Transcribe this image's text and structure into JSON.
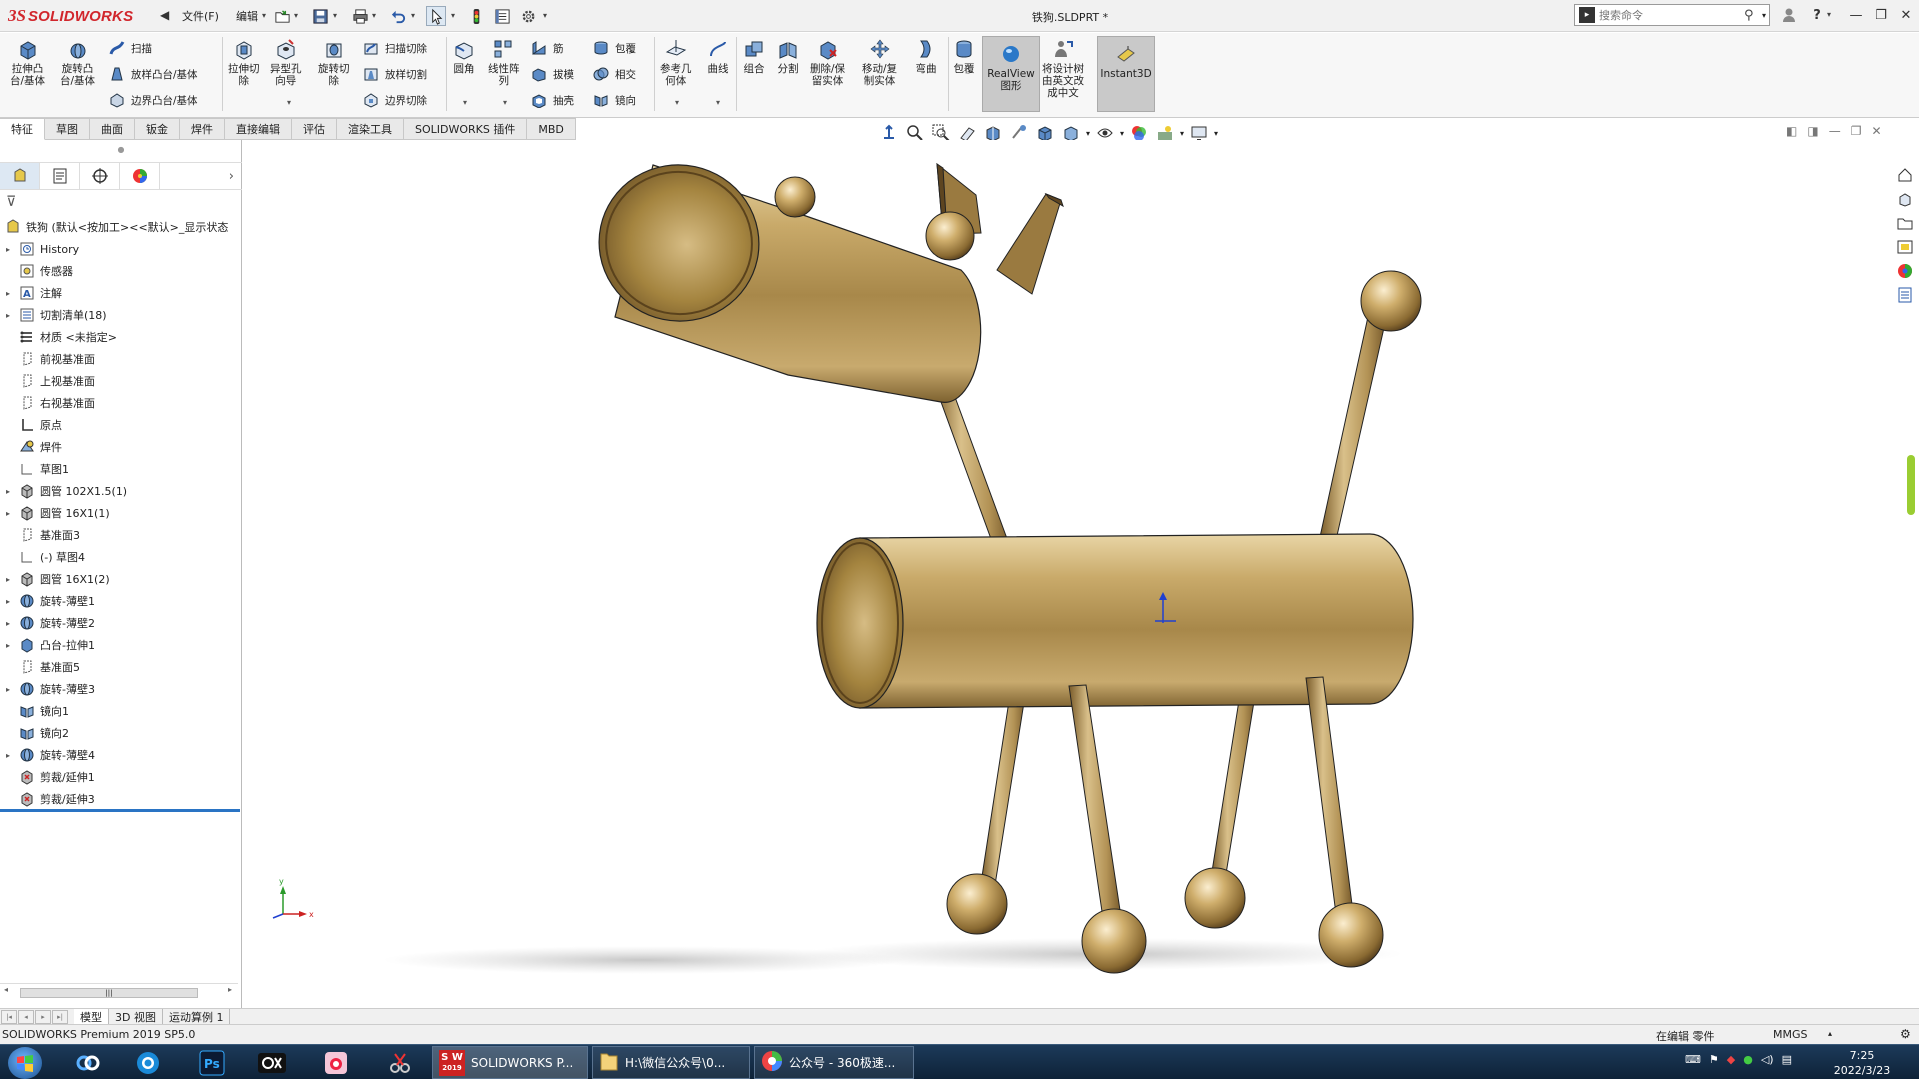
{
  "app": {
    "logo_ds": "3S",
    "logo_text": "SOLIDWORKS",
    "doc_title": "铁狗.SLDPRT *"
  },
  "menu": {
    "file": "文件(F)",
    "edit": "编辑"
  },
  "search": {
    "placeholder": "搜索命令"
  },
  "ribbon": {
    "extrude_boss": "拉伸凸\n台/基体",
    "revolve_boss": "旋转凸\n台/基体",
    "sweep": "扫描",
    "loft_boss": "放样凸台/基体",
    "boundary_boss": "边界凸台/基体",
    "extrude_cut": "拉伸切\n除",
    "hole_wizard": "异型孔\n向导",
    "revolve_cut": "旋转切\n除",
    "swept_cut": "扫描切除",
    "lofted_cut": "放样切割",
    "boundary_cut": "边界切除",
    "fillet": "圆角",
    "linear_pattern": "线性阵\n列",
    "rib": "筋",
    "draft": "拔模",
    "shell": "抽壳",
    "wrap": "包覆",
    "intersect": "相交",
    "mirror": "镜向",
    "ref_geometry": "参考几\n何体",
    "curves": "曲线",
    "combine": "组合",
    "split": "分割",
    "delete_body": "删除/保\n留实体",
    "move_copy": "移动/复\n制实体",
    "flex": "弯曲",
    "wrap2": "包覆",
    "realview": "RealView\n图形",
    "translate_tree": "将设计树\n由英文改\n成中文",
    "instant3d": "Instant3D"
  },
  "tabs": [
    "特征",
    "草图",
    "曲面",
    "钣金",
    "焊件",
    "直接编辑",
    "评估",
    "渲染工具",
    "SOLIDWORKS 插件",
    "MBD"
  ],
  "tree": {
    "root": "铁狗 (默认<按加工><<默认>_显示状态",
    "items": [
      {
        "label": "History",
        "icon": "history-icon",
        "expand": true
      },
      {
        "label": "传感器",
        "icon": "sensor-icon",
        "expand": false
      },
      {
        "label": "注解",
        "icon": "annotation-icon",
        "expand": true
      },
      {
        "label": "切割清单(18)",
        "icon": "cut-list-icon",
        "expand": true
      },
      {
        "label": "材质 <未指定>",
        "icon": "material-icon",
        "expand": false
      },
      {
        "label": "前视基准面",
        "icon": "plane-icon",
        "expand": false
      },
      {
        "label": "上视基准面",
        "icon": "plane-icon",
        "expand": false
      },
      {
        "label": "右视基准面",
        "icon": "plane-icon",
        "expand": false
      },
      {
        "label": "原点",
        "icon": "origin-icon",
        "expand": false
      },
      {
        "label": "焊件",
        "icon": "weldment-icon",
        "expand": false
      },
      {
        "label": "草图1",
        "icon": "sketch-icon",
        "expand": false
      },
      {
        "label": "圆管 102X1.5(1)",
        "icon": "structural-member-icon",
        "expand": true
      },
      {
        "label": "圆管 16X1(1)",
        "icon": "structural-member-icon",
        "expand": true
      },
      {
        "label": "基准面3",
        "icon": "plane-icon",
        "expand": false
      },
      {
        "label": "(-) 草图4",
        "icon": "sketch-icon",
        "expand": false
      },
      {
        "label": "圆管 16X1(2)",
        "icon": "structural-member-icon",
        "expand": true
      },
      {
        "label": "旋转-薄壁1",
        "icon": "revolve-icon",
        "expand": true
      },
      {
        "label": "旋转-薄壁2",
        "icon": "revolve-icon",
        "expand": true
      },
      {
        "label": "凸台-拉伸1",
        "icon": "extrude-icon",
        "expand": true
      },
      {
        "label": "基准面5",
        "icon": "plane-icon",
        "expand": false
      },
      {
        "label": "旋转-薄壁3",
        "icon": "revolve-icon",
        "expand": true
      },
      {
        "label": "镜向1",
        "icon": "mirror-icon",
        "expand": false
      },
      {
        "label": "镜向2",
        "icon": "mirror-icon",
        "expand": false
      },
      {
        "label": "旋转-薄壁4",
        "icon": "revolve-icon",
        "expand": true
      },
      {
        "label": "剪裁/延伸1",
        "icon": "trim-extend-icon",
        "expand": false
      },
      {
        "label": "剪裁/延伸3",
        "icon": "trim-extend-icon",
        "expand": false
      }
    ]
  },
  "bottom_tabs": [
    "模型",
    "3D 视图",
    "运动算例 1"
  ],
  "status": {
    "product": "SOLIDWORKS Premium 2019 SP5.0",
    "editing": "在编辑 零件",
    "units": "MMGS"
  },
  "taskbar": {
    "sw_app": "SOLIDWORKS P...",
    "folder_app": "H:\\微信公众号\\0...",
    "browser_app": "公众号 - 360极速...",
    "time": "7:25",
    "date": "2022/3/23",
    "sw_year": "2019"
  },
  "colors": {
    "brass": "#b8965a",
    "accent": "#d1262c",
    "selection": "#2a74c4"
  }
}
